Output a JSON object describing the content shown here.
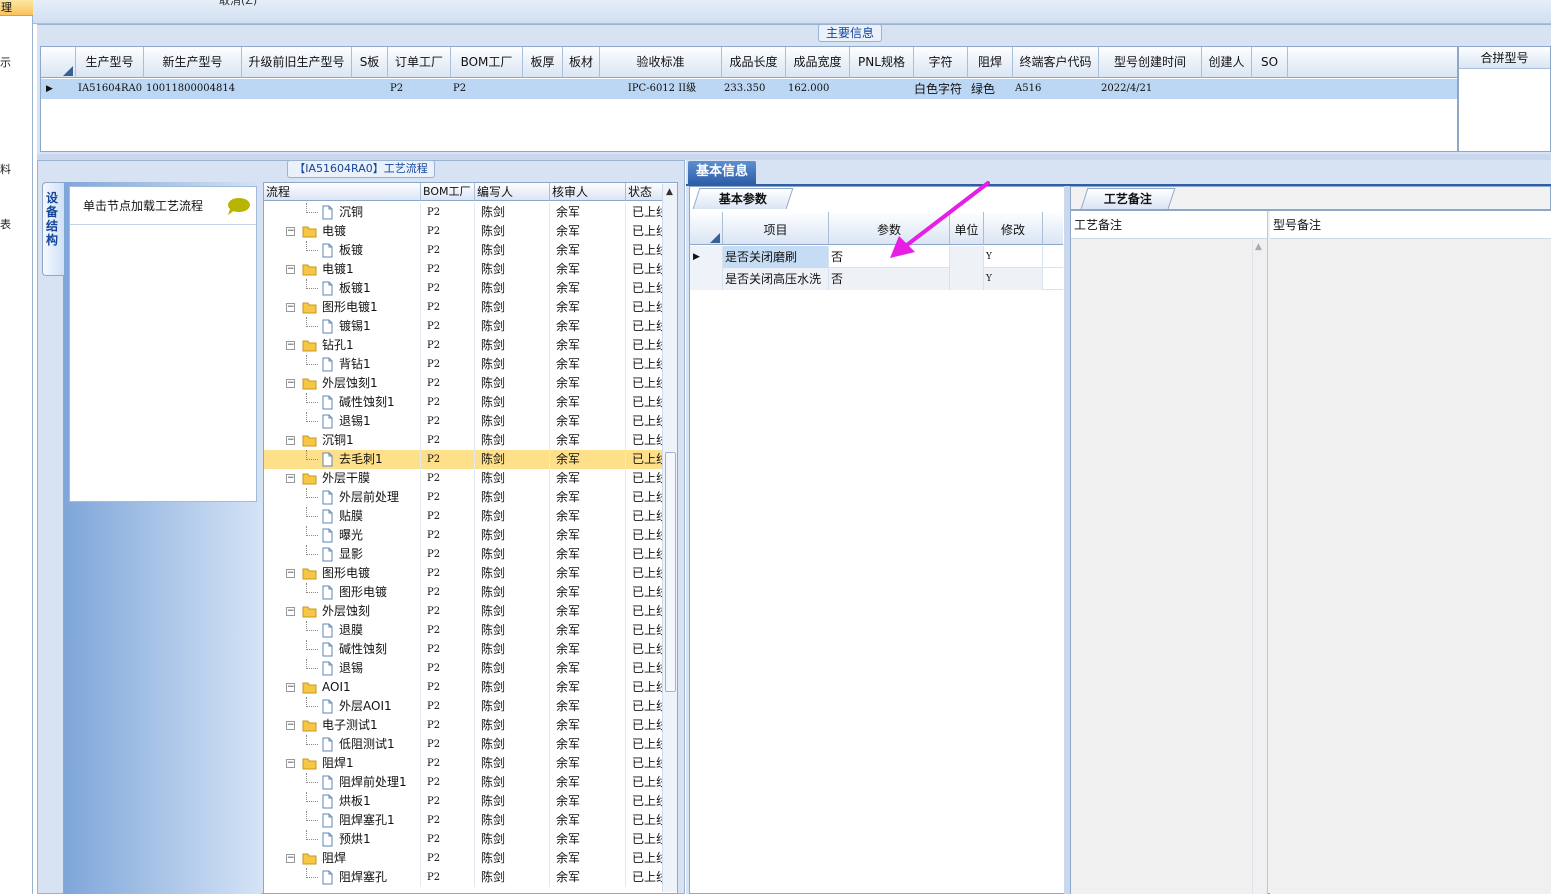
{
  "left_strip": {
    "selected_label": "理",
    "fragments": [
      "示",
      "料",
      "表"
    ]
  },
  "toolbar": {
    "cut_label": "取消(Z)"
  },
  "main_info": {
    "title": "主要信息",
    "columns": [
      "生产型号",
      "新生产型号",
      "升级前旧生产型号",
      "S板",
      "订单工厂",
      "BOM工厂",
      "板厚",
      "板材",
      "验收标准",
      "成品长度",
      "成品宽度",
      "PNL规格",
      "字符",
      "阻焊",
      "终端客户代码",
      "型号创建时间",
      "创建人",
      "SO"
    ],
    "row": {
      "model": "IA51604RA0",
      "new_model": "10011800004814",
      "order_factory": "P2",
      "bom_factory": "P2",
      "standard": "IPC-6012 II级",
      "length": "233.350",
      "width": "162.000",
      "char": "白色字符",
      "solder": "绿色",
      "customer": "A516",
      "created": "2022/4/21"
    },
    "merge_header": "合拼型号"
  },
  "process": {
    "title": "【IA51604RA0】工艺流程",
    "side_tab": "设备结构",
    "side_hint": "单击节点加载工艺流程",
    "columns": [
      "流程",
      "BOM工厂",
      "编写人",
      "核审人",
      "状态"
    ],
    "rows": [
      {
        "name": "沉铜",
        "level": 1,
        "bom": "P2",
        "writer": "陈剑",
        "reviewer": "余军",
        "status": "已上线"
      },
      {
        "name": "电镀",
        "level": 0,
        "bom": "P2",
        "writer": "陈剑",
        "reviewer": "余军",
        "status": "已上线"
      },
      {
        "name": "板镀",
        "level": 1,
        "bom": "P2",
        "writer": "陈剑",
        "reviewer": "余军",
        "status": "已上线"
      },
      {
        "name": "电镀1",
        "level": 0,
        "bom": "P2",
        "writer": "陈剑",
        "reviewer": "余军",
        "status": "已上线"
      },
      {
        "name": "板镀1",
        "level": 1,
        "bom": "P2",
        "writer": "陈剑",
        "reviewer": "余军",
        "status": "已上线"
      },
      {
        "name": "图形电镀1",
        "level": 0,
        "bom": "P2",
        "writer": "陈剑",
        "reviewer": "余军",
        "status": "已上线"
      },
      {
        "name": "镀锡1",
        "level": 1,
        "bom": "P2",
        "writer": "陈剑",
        "reviewer": "余军",
        "status": "已上线"
      },
      {
        "name": "钻孔1",
        "level": 0,
        "bom": "P2",
        "writer": "陈剑",
        "reviewer": "余军",
        "status": "已上线"
      },
      {
        "name": "背钻1",
        "level": 1,
        "bom": "P2",
        "writer": "陈剑",
        "reviewer": "余军",
        "status": "已上线"
      },
      {
        "name": "外层蚀刻1",
        "level": 0,
        "bom": "P2",
        "writer": "陈剑",
        "reviewer": "余军",
        "status": "已上线"
      },
      {
        "name": "碱性蚀刻1",
        "level": 1,
        "bom": "P2",
        "writer": "陈剑",
        "reviewer": "余军",
        "status": "已上线"
      },
      {
        "name": "退锡1",
        "level": 1,
        "bom": "P2",
        "writer": "陈剑",
        "reviewer": "余军",
        "status": "已上线"
      },
      {
        "name": "沉铜1",
        "level": 0,
        "bom": "P2",
        "writer": "陈剑",
        "reviewer": "余军",
        "status": "已上线"
      },
      {
        "name": "去毛刺1",
        "level": 1,
        "bom": "P2",
        "writer": "陈剑",
        "reviewer": "余军",
        "status": "已上线",
        "selected": true
      },
      {
        "name": "外层干膜",
        "level": 0,
        "bom": "P2",
        "writer": "陈剑",
        "reviewer": "余军",
        "status": "已上线"
      },
      {
        "name": "外层前处理",
        "level": 1,
        "bom": "P2",
        "writer": "陈剑",
        "reviewer": "余军",
        "status": "已上线"
      },
      {
        "name": "贴膜",
        "level": 1,
        "bom": "P2",
        "writer": "陈剑",
        "reviewer": "余军",
        "status": "已上线"
      },
      {
        "name": "曝光",
        "level": 1,
        "bom": "P2",
        "writer": "陈剑",
        "reviewer": "余军",
        "status": "已上线"
      },
      {
        "name": "显影",
        "level": 1,
        "bom": "P2",
        "writer": "陈剑",
        "reviewer": "余军",
        "status": "已上线"
      },
      {
        "name": "图形电镀",
        "level": 0,
        "bom": "P2",
        "writer": "陈剑",
        "reviewer": "余军",
        "status": "已上线"
      },
      {
        "name": "图形电镀",
        "level": 1,
        "bom": "P2",
        "writer": "陈剑",
        "reviewer": "余军",
        "status": "已上线"
      },
      {
        "name": "外层蚀刻",
        "level": 0,
        "bom": "P2",
        "writer": "陈剑",
        "reviewer": "余军",
        "status": "已上线"
      },
      {
        "name": "退膜",
        "level": 1,
        "bom": "P2",
        "writer": "陈剑",
        "reviewer": "余军",
        "status": "已上线"
      },
      {
        "name": "碱性蚀刻",
        "level": 1,
        "bom": "P2",
        "writer": "陈剑",
        "reviewer": "余军",
        "status": "已上线"
      },
      {
        "name": "退锡",
        "level": 1,
        "bom": "P2",
        "writer": "陈剑",
        "reviewer": "余军",
        "status": "已上线"
      },
      {
        "name": "AOI1",
        "level": 0,
        "bom": "P2",
        "writer": "陈剑",
        "reviewer": "余军",
        "status": "已上线"
      },
      {
        "name": "外层AOI1",
        "level": 1,
        "bom": "P2",
        "writer": "陈剑",
        "reviewer": "余军",
        "status": "已上线"
      },
      {
        "name": "电子测试1",
        "level": 0,
        "bom": "P2",
        "writer": "陈剑",
        "reviewer": "余军",
        "status": "已上线"
      },
      {
        "name": "低阻测试1",
        "level": 1,
        "bom": "P2",
        "writer": "陈剑",
        "reviewer": "余军",
        "status": "已上线"
      },
      {
        "name": "阻焊1",
        "level": 0,
        "bom": "P2",
        "writer": "陈剑",
        "reviewer": "余军",
        "status": "已上线"
      },
      {
        "name": "阻焊前处理1",
        "level": 1,
        "bom": "P2",
        "writer": "陈剑",
        "reviewer": "余军",
        "status": "已上线"
      },
      {
        "name": "烘板1",
        "level": 1,
        "bom": "P2",
        "writer": "陈剑",
        "reviewer": "余军",
        "status": "已上线"
      },
      {
        "name": "阻焊塞孔1",
        "level": 1,
        "bom": "P2",
        "writer": "陈剑",
        "reviewer": "余军",
        "status": "已上线"
      },
      {
        "name": "预烘1",
        "level": 1,
        "bom": "P2",
        "writer": "陈剑",
        "reviewer": "余军",
        "status": "已上线"
      },
      {
        "name": "阻焊",
        "level": 0,
        "bom": "P2",
        "writer": "陈剑",
        "reviewer": "余军",
        "status": "已上线"
      },
      {
        "name": "阻焊塞孔",
        "level": 1,
        "bom": "P2",
        "writer": "陈剑",
        "reviewer": "余军",
        "status": "已上线"
      }
    ]
  },
  "basic_info": {
    "tab": "基本信息",
    "params_tab": "基本参数",
    "param_columns": [
      "项目",
      "参数",
      "单位",
      "修改"
    ],
    "params": [
      {
        "item": "是否关闭磨刷",
        "value": "否",
        "unit": "",
        "modify": "Y"
      },
      {
        "item": "是否关闭高压水洗",
        "value": "否",
        "unit": "",
        "modify": "Y"
      }
    ],
    "craft_tab": "工艺备注",
    "craft_remark_header": "工艺备注",
    "model_remark_header": "型号备注"
  },
  "colors": {
    "accent_arrow": "#e61ee6",
    "selection": "#ffe08a",
    "row_highlight": "#bcd7f4"
  },
  "icons": {
    "folder": "folder-icon",
    "document": "document-icon",
    "bubble": "speech-bubble-icon"
  }
}
